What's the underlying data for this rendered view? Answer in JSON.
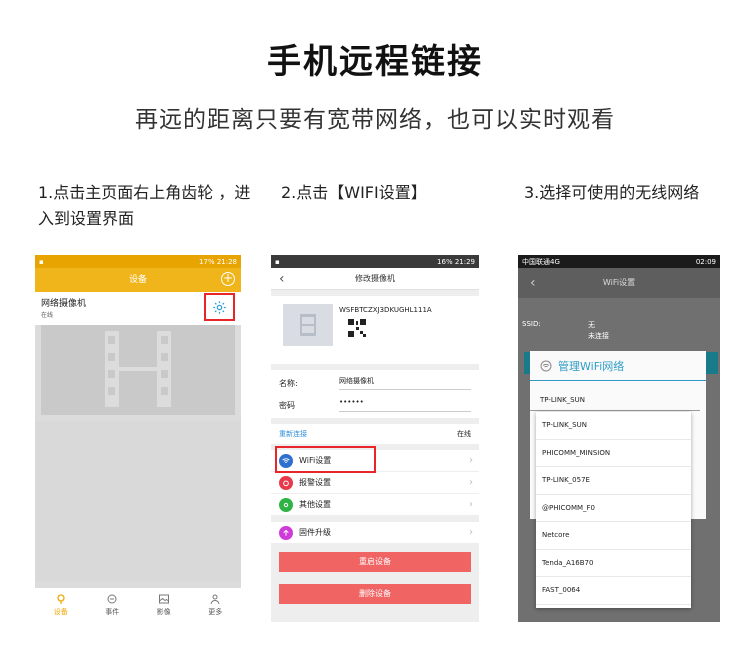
{
  "title": "手机远程链接",
  "subtitle": "再远的距离只要有宽带网络，也可以实时观看",
  "steps": [
    "1.点击主页面右上角齿轮 ，进入到设置界面",
    "2.点击【WIFI设置】",
    "3.选择可使用的无线网络"
  ],
  "colors": {
    "accent_orange": "#f1b51c",
    "highlight_red": "#e8262a",
    "danger_button": "#f06464",
    "link_blue": "#2f8fd8",
    "dialog_blue": "#2f9bc4"
  },
  "phone1": {
    "status_time": "17% 21:28",
    "header_title": "设备",
    "camera_name": "网络摄像机",
    "camera_status": "在线",
    "tabs": [
      "设备",
      "事件",
      "影像",
      "更多"
    ]
  },
  "phone2": {
    "status_time": "16% 21:29",
    "header_title": "修改摄像机",
    "device_id": "WSFBTCZXJ3DKUGHL111A",
    "name_label": "名称:",
    "name_value": "网络摄像机",
    "password_label": "密码",
    "password_value": "••••••",
    "reconnect_label": "重新连接",
    "online_label": "在线",
    "menu": [
      "WiFi设置",
      "报警设置",
      "其他设置"
    ],
    "firmware": "固件升级",
    "restart_button": "重启设备",
    "delete_button": "删除设备"
  },
  "phone3": {
    "status_carrier": "中国联通4G",
    "status_time": "02:09",
    "header_title": "WiFi设置",
    "ssid_label": "SSID:",
    "ssid_value": "无",
    "ssid_status": "未连接",
    "dialog_title": "管理WiFi网络",
    "selected_network": "TP-LINK_SUN",
    "networks": [
      "TP-LINK_SUN",
      "PHICOMM_MINSION",
      "TP-LINK_057E",
      "@PHICOMM_F0",
      "Netcore",
      "Tenda_A16B70",
      "FAST_0064"
    ]
  }
}
